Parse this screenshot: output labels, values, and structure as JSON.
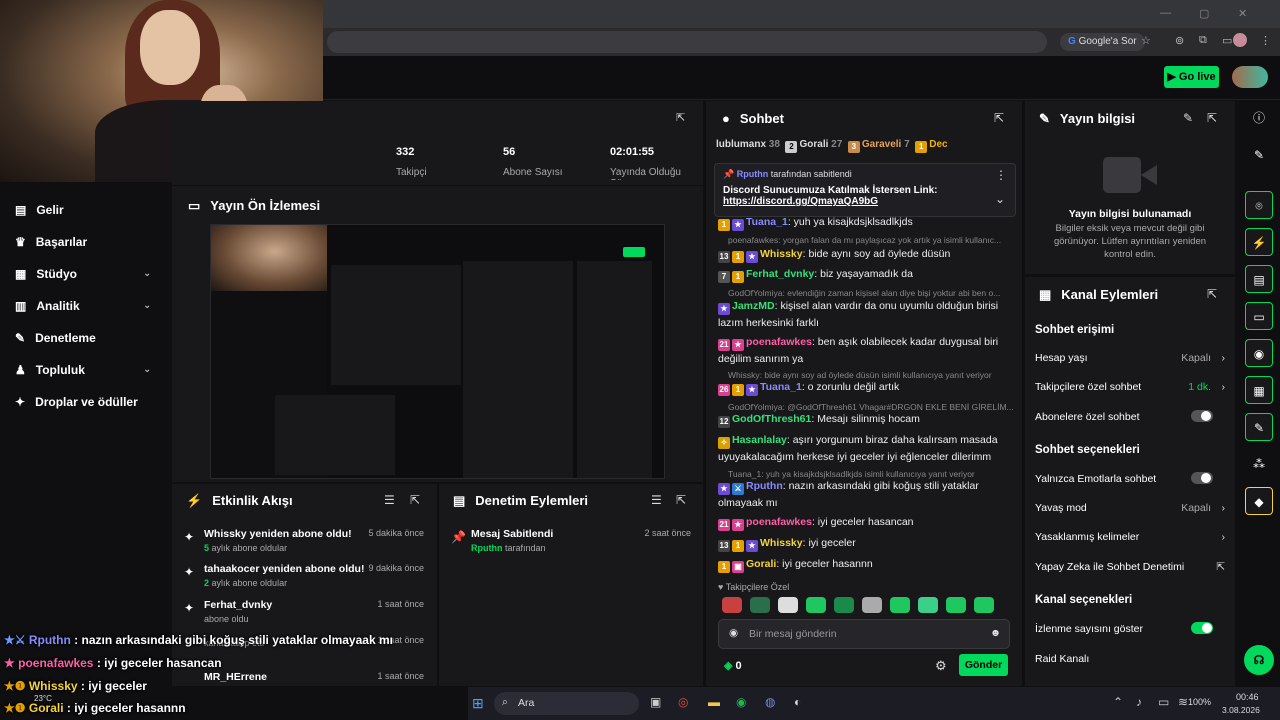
{
  "browser": {
    "google_sor": "Google'a Sor"
  },
  "appbar": {
    "golive": "Go live"
  },
  "nav": {
    "items": [
      "Gelir",
      "Başarılar",
      "Stüdyo",
      "Analitik",
      "Denetleme",
      "Topluluk",
      "Droplar ve ödüller"
    ]
  },
  "stats": [
    {
      "value": "332",
      "label": "Takipçi"
    },
    {
      "value": "56",
      "label": "Abone Sayısı"
    },
    {
      "value": "02:01:55",
      "label": "Yayında Olduğu Süre"
    }
  ],
  "preview": {
    "title": "Yayın Ön İzlemesi"
  },
  "activity": {
    "title": "Etkinlik Akışı",
    "items": [
      {
        "title": "Whissky yeniden abone oldu!",
        "sub_num": "5",
        "sub": " aylık abone oldular",
        "time": "5 dakika önce"
      },
      {
        "title": "tahaakocer yeniden abone oldu!",
        "sub_num": "2",
        "sub": " aylık abone oldular",
        "time": "9 dakika önce"
      },
      {
        "title": "Ferhat_dvnky",
        "sub_num": "",
        "sub": "abone oldu",
        "time": "1 saat önce"
      },
      {
        "title": "",
        "sub_num": "",
        "sub": "kanalı takip etti",
        "time": "1 saat önce"
      },
      {
        "title": "MR_HErrene",
        "sub_num": "",
        "sub": "",
        "time": "1 saat önce"
      }
    ]
  },
  "moderation": {
    "title": "Denetim Eylemleri",
    "item_title": "Mesaj Sabitlendi",
    "item_user": "Rputhn",
    "item_suffix": " tarafından",
    "item_time": "2 saat önce"
  },
  "chat": {
    "title": "Sohbet",
    "gifters": [
      {
        "name": "lublumanx",
        "count": "38"
      },
      {
        "name": "Gorali",
        "count": "27"
      },
      {
        "name": "Garaveli",
        "count": "7"
      },
      {
        "name": "Dec",
        "count": ""
      }
    ],
    "pinned_by": "Rputhn",
    "pinned_by_suffix": " tarafından sabitlendi",
    "pinned_text": "Discord Sunucumuza Katılmak İstersen Link:",
    "pinned_link": "https://discord.gg/QmayaQA9bG",
    "messages": [
      {
        "reply": "",
        "user": "Tuana_1",
        "color": "#8a8aff",
        "text": ": yuh ya kisajkdsjklsadlkjds"
      },
      {
        "reply": "poenafawkes: yorgan falan da mı paylaşıcaz yok artık ya isimli kullanıc...",
        "user": "Whissky",
        "color": "#f5d33a",
        "text": ": bide aynı soy ad öylede düsün"
      },
      {
        "reply": "",
        "user": "Ferhat_dvnky",
        "color": "#36e07a",
        "text": ": biz yaşayamadık da"
      },
      {
        "reply": "GodOfYolmiya: evlendiğin zaman kişisel alan diye bişi yoktur abi ben o...",
        "user": "JamzMD",
        "color": "#36e07a",
        "text": ": kişisel alan vardır da onu uyumlu olduğun birisi lazım herkesinki farklı"
      },
      {
        "reply": "",
        "user": "poenafawkes",
        "color": "#ff5fa8",
        "text": ": ben aşık olabilecek kadar duygusal biri değilim sanırım ya"
      },
      {
        "reply": "Whissky: bide aynı soy ad öylede düsün isimli kullanıcıya yanıt veriyor",
        "user": "Tuana_1",
        "color": "#8a8aff",
        "text": ": o zorunlu değil artık"
      },
      {
        "reply": "GodOfYolmiya: @GodOfThresh61 Vhagar#DRGON EKLE BENİ GİRELİM...",
        "user": "GodOfThresh61",
        "color": "#36e07a",
        "text": ": Mesajı silinmiş hocam"
      },
      {
        "reply": "",
        "user": "Hasanlalay",
        "color": "#36e07a",
        "text": ": aşırı yorgunum biraz daha kalırsam masada uyuyakalacağım herkese iyi geceler iyi eğlenceler dilerimm"
      },
      {
        "reply": "Tuana_1: yuh ya kisajkdsjklsadlkjds isimli kullanıcıya yanıt veriyor",
        "user": "Rputhn",
        "color": "#8a8aff",
        "text": ": nazın arkasındaki gibi koğuş stili yataklar olmayaak mı"
      },
      {
        "reply": "",
        "user": "poenafawkes",
        "color": "#ff5fa8",
        "text": ": iyi geceler hasancan"
      },
      {
        "reply": "",
        "user": "Whissky",
        "color": "#f5d33a",
        "text": ": iyi geceler"
      },
      {
        "reply": "",
        "user": "Gorali",
        "color": "#f5d33a",
        "text": ": iyi geceler hasannn"
      }
    ],
    "followers_only": "Takipçilere Özel",
    "input_placeholder": "Bir mesaj gönderin",
    "points": "0",
    "send": "Gönder"
  },
  "info": {
    "title": "Yayın bilgisi",
    "empty_title": "Yayın bilgisi bulunamadı",
    "empty_text": "Bilgiler eksik veya mevcut değil gibi görünüyor. Lütfen ayrıntıları yeniden kontrol edin."
  },
  "actions": {
    "title": "Kanal Eylemleri",
    "sec1": "Sohbet erişimi",
    "account_age": "Hesap yaşı",
    "account_age_val": "Kapalı",
    "followers_chat": "Takipçilere özel sohbet",
    "followers_chat_val": "1 dk.",
    "subs_chat": "Abonelere özel sohbet",
    "sec2": "Sohbet seçenekleri",
    "emote_only": "Yalnızca Emotlarla sohbet",
    "slow_mode": "Yavaş mod",
    "slow_mode_val": "Kapalı",
    "banned_words": "Yasaklanmış kelimeler",
    "ai_mod": "Yapay Zeka ile Sohbet Denetimi",
    "sec3": "Kanal seçenekleri",
    "view_count": "İzlenme sayısını göster",
    "raid": "Raid Kanalı"
  },
  "overlay": [
    {
      "user": "Rputhn",
      "color": "#8a8aff",
      "text": " : nazın arkasındaki gibi koğuş stili yataklar olmayaak mı"
    },
    {
      "user": "poenafawkes",
      "color": "#ff5fa8",
      "text": " : iyi geceler hasancan"
    },
    {
      "user": "Whissky",
      "color": "#f5d33a",
      "text": " : iyi geceler"
    },
    {
      "user": "Gorali",
      "color": "#f5d33a",
      "text": " : iyi geceler hasannn"
    }
  ],
  "taskbar": {
    "search": "Ara",
    "battery": "100%",
    "time": "00:46",
    "date": "3.08.2026",
    "temp": "23°C"
  }
}
